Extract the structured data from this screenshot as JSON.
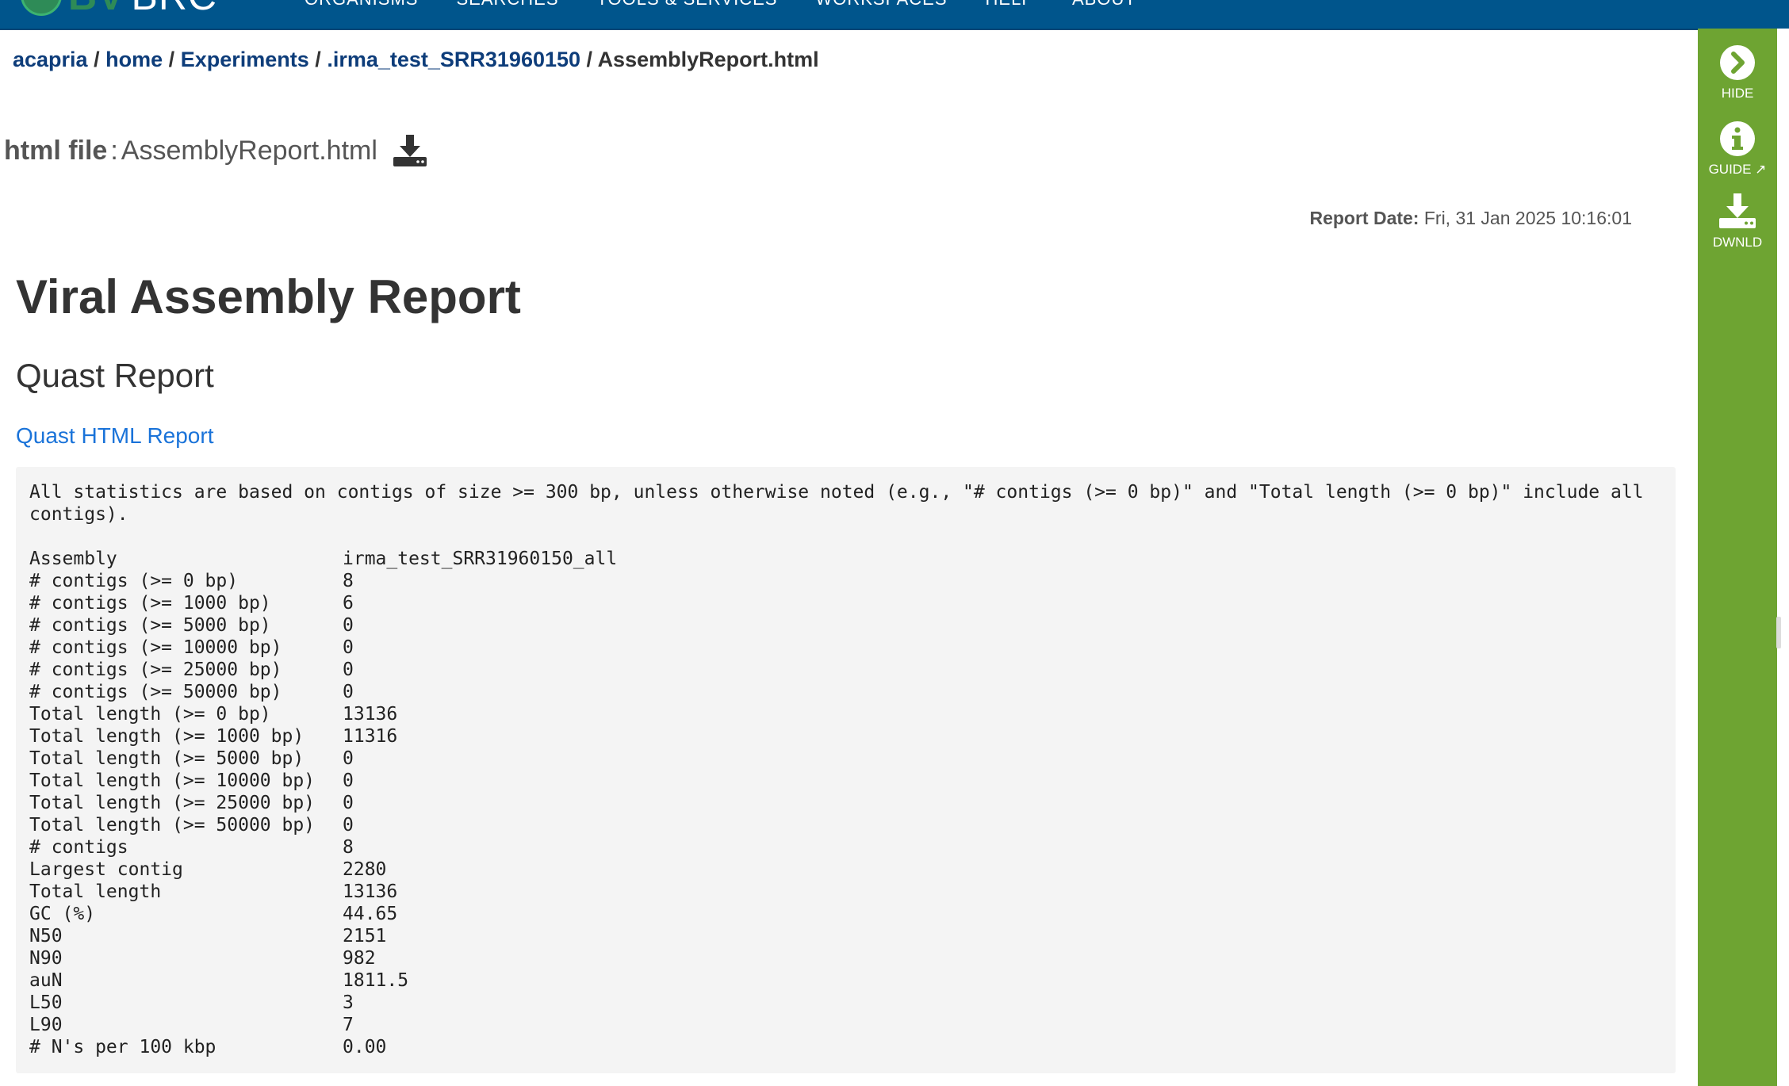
{
  "navbar": {
    "logo_bv": "BV",
    "logo_brc": "BRC",
    "menu": [
      "ORGANISMS",
      "SEARCHES",
      "TOOLS & SERVICES",
      "WORKSPACES",
      "HELP",
      "ABOUT"
    ]
  },
  "breadcrumb": {
    "items": [
      "acapria",
      "home",
      "Experiments",
      ".irma_test_SRR31960150"
    ],
    "separator": "/",
    "current": "AssemblyReport.html"
  },
  "file": {
    "type_label": "html file",
    "colon": ":",
    "name": "AssemblyReport.html"
  },
  "report": {
    "date_label": "Report Date:",
    "date_value": "Fri, 31 Jan 2025 10:16:01",
    "title": "Viral Assembly Report",
    "section_title": "Quast Report",
    "link_label": "Quast HTML Report",
    "note": "All statistics are based on contigs of size >= 300 bp, unless otherwise noted (e.g., \"# contigs (>= 0 bp)\" and \"Total length (>= 0 bp)\" include all contigs).",
    "stats": [
      {
        "key": "Assembly",
        "value": "irma_test_SRR31960150_all"
      },
      {
        "key": "# contigs (>= 0 bp)",
        "value": "8"
      },
      {
        "key": "# contigs (>= 1000 bp)",
        "value": "6"
      },
      {
        "key": "# contigs (>= 5000 bp)",
        "value": "0"
      },
      {
        "key": "# contigs (>= 10000 bp)",
        "value": "0"
      },
      {
        "key": "# contigs (>= 25000 bp)",
        "value": "0"
      },
      {
        "key": "# contigs (>= 50000 bp)",
        "value": "0"
      },
      {
        "key": "Total length (>= 0 bp)",
        "value": "13136"
      },
      {
        "key": "Total length (>= 1000 bp)",
        "value": "11316"
      },
      {
        "key": "Total length (>= 5000 bp)",
        "value": "0"
      },
      {
        "key": "Total length (>= 10000 bp)",
        "value": "0"
      },
      {
        "key": "Total length (>= 25000 bp)",
        "value": "0"
      },
      {
        "key": "Total length (>= 50000 bp)",
        "value": "0"
      },
      {
        "key": "# contigs",
        "value": "8"
      },
      {
        "key": "Largest contig",
        "value": "2280"
      },
      {
        "key": "Total length",
        "value": "13136"
      },
      {
        "key": "GC (%)",
        "value": "44.65"
      },
      {
        "key": "N50",
        "value": "2151"
      },
      {
        "key": "N90",
        "value": "982"
      },
      {
        "key": "auN",
        "value": "1811.5"
      },
      {
        "key": "L50",
        "value": "3"
      },
      {
        "key": "L90",
        "value": "7"
      },
      {
        "key": "# N's per 100 kbp",
        "value": "0.00"
      }
    ]
  },
  "side_panel": {
    "hide_label": "HIDE",
    "guide_label": "GUIDE",
    "download_label": "DWNLD"
  },
  "colors": {
    "navbar": "#00558c",
    "side_panel": "#6ea432",
    "link": "#1a73d9",
    "breadcrumb_link": "#0e3d7a",
    "stats_background": "#f4f4f4"
  },
  "icons": [
    "chevron-right-circle-icon",
    "info-circle-icon",
    "external-link-icon",
    "download-icon"
  ]
}
